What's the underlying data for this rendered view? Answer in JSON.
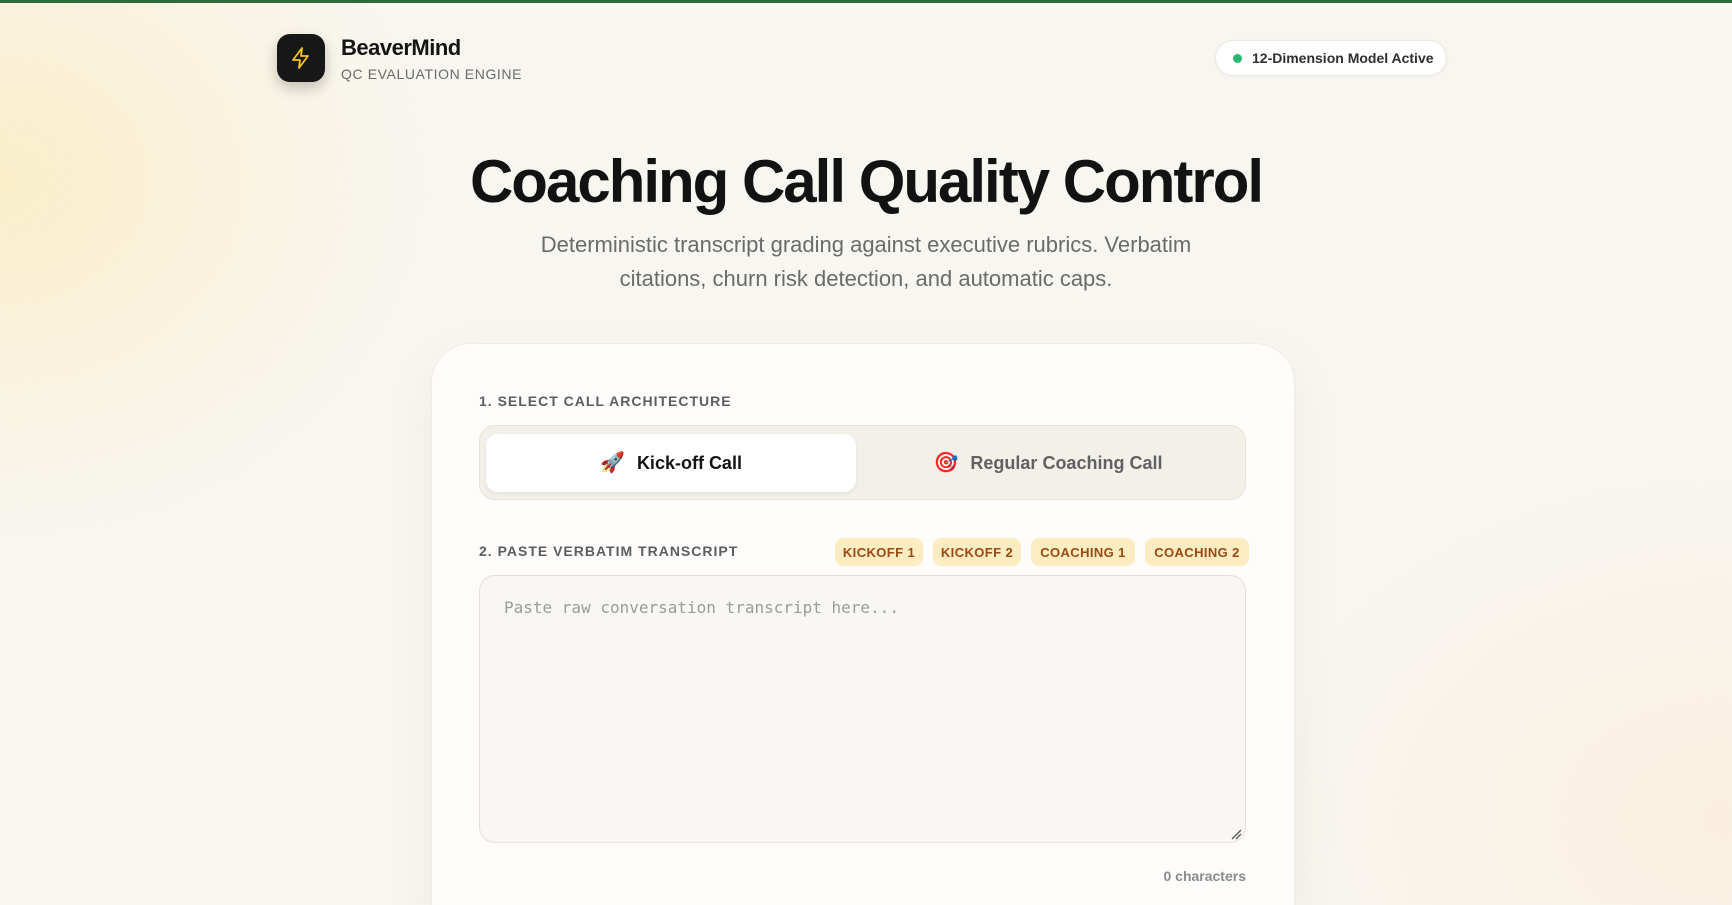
{
  "brand": {
    "name": "BeaverMind",
    "subtitle": "QC EVALUATION ENGINE",
    "logo_icon": "lightning-bolt-icon"
  },
  "status": {
    "label": "12-Dimension Model Active",
    "dot_color": "#2bb673"
  },
  "hero": {
    "title": "Coaching Call Quality Control",
    "subtitle": "Deterministic transcript grading against executive rubrics. Verbatim citations, churn risk detection, and automatic caps."
  },
  "call_architecture": {
    "label": "1. SELECT CALL ARCHITECTURE",
    "options": [
      {
        "icon": "🚀",
        "label": "Kick-off Call",
        "selected": true
      },
      {
        "icon": "🎯",
        "label": "Regular Coaching Call",
        "selected": false
      }
    ]
  },
  "transcript": {
    "label": "2. PASTE VERBATIM TRANSCRIPT",
    "samples": [
      "KICKOFF 1",
      "KICKOFF 2",
      "COACHING 1",
      "COACHING 2"
    ],
    "placeholder": "Paste raw conversation transcript here...",
    "value": "",
    "char_count": "0 characters"
  },
  "colors": {
    "accent_stripe": "#2f6b3a",
    "chip_bg": "#fcecc2",
    "chip_text": "#9a4a12",
    "logo_bolt": "#f5c518"
  }
}
